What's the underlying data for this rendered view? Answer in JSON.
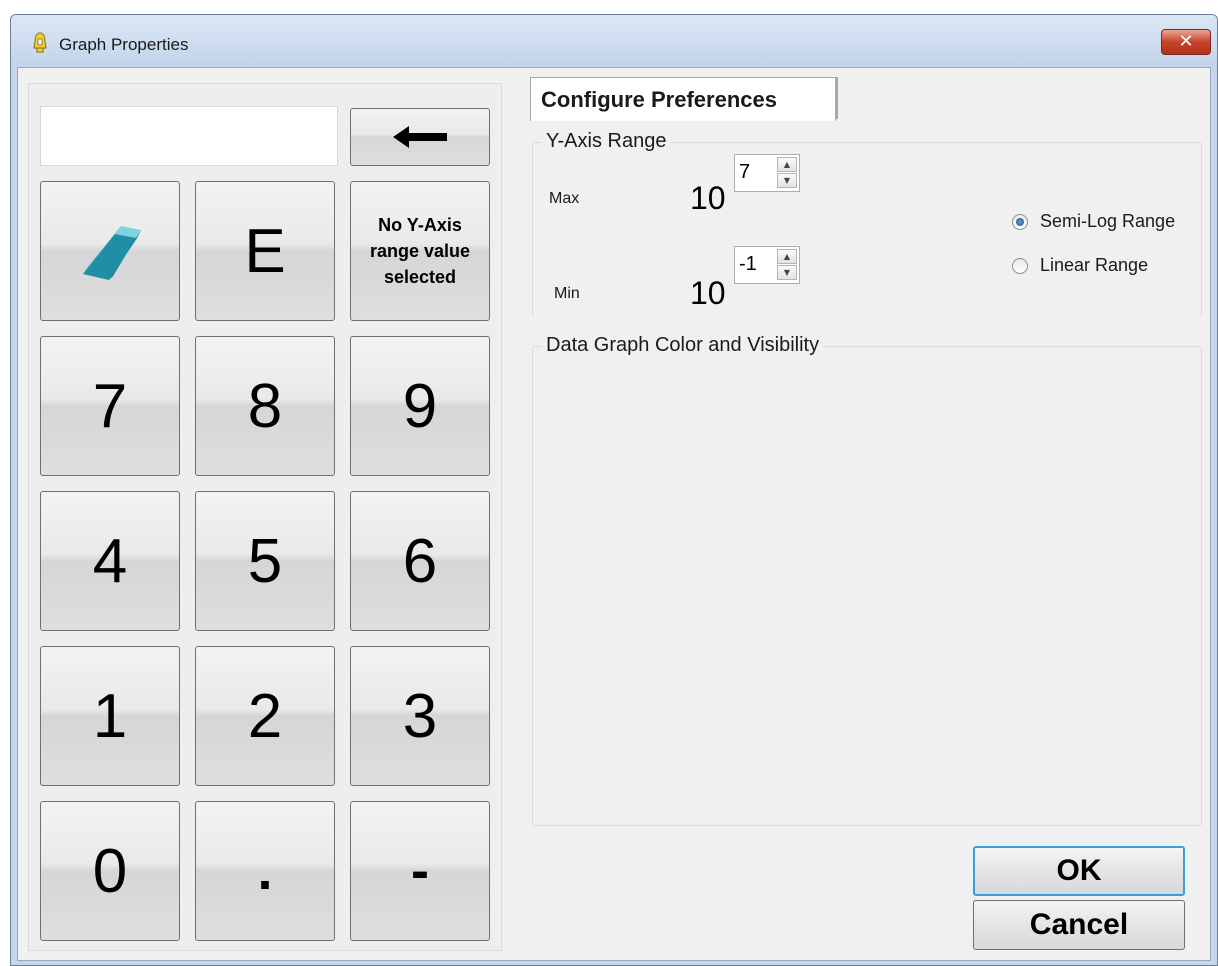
{
  "window": {
    "title": "Graph Properties",
    "close_icon": "close-icon",
    "app_icon": "bell-icon"
  },
  "keypad": {
    "entry_value": "",
    "backspace_icon": "left-arrow-icon",
    "clear_icon": "eraser-icon",
    "exponent_label": "E",
    "no_yaxis_label": "No Y-Axis range value selected",
    "keys": {
      "seven": "7",
      "eight": "8",
      "nine": "9",
      "four": "4",
      "five": "5",
      "six": "6",
      "one": "1",
      "two": "2",
      "three": "3",
      "zero": "0",
      "dot": ".",
      "minus": "-"
    }
  },
  "tabs": [
    {
      "label": "Configure Preferences",
      "selected": true
    }
  ],
  "y_axis": {
    "legend": "Y-Axis Range",
    "max_label": "Max",
    "min_label": "Min",
    "base": "10",
    "max_exponent": "7",
    "min_exponent": "-1",
    "range_options": [
      {
        "label": "Semi-Log Range",
        "selected": true
      },
      {
        "label": "Linear Range",
        "selected": false
      }
    ]
  },
  "data_graph": {
    "legend": "Data Graph Color and Visibility"
  },
  "buttons": {
    "ok": "OK",
    "cancel": "Cancel"
  },
  "colors": {
    "title_bar": "#c6d7eb",
    "close_button": "#c8432b",
    "default_button_border": "#3b9ee0",
    "eraser": "#2a9fb3"
  }
}
